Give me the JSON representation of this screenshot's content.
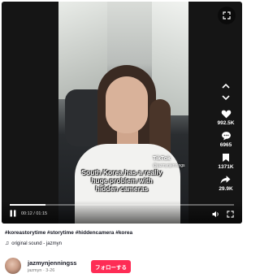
{
  "video": {
    "caption": "South Korea has a really huge problem with hidden cameras",
    "watermark": {
      "brand": "TikTok",
      "handle": "@jazmynjennings"
    },
    "actions": {
      "like_count": "992.5K",
      "comment_count": "6965",
      "save_count": "1371K",
      "share_count": "29.9K"
    },
    "player": {
      "time": "00:12 / 01:15",
      "progress": 0.16
    }
  },
  "post": {
    "hashtags": "#koreastorytime #storytime #hiddencamera #korea",
    "sound": "original sound - jazmyn",
    "author_name": "jazmynjenningss",
    "author_sub": "jazmyn · 3-26",
    "follow_label": "フォローする"
  },
  "colors": {
    "accent": "#fe2c55",
    "text": "#161823",
    "video_bg": "#151515"
  },
  "icons": [
    "expand-icon",
    "chevron-up-icon",
    "chevron-down-icon",
    "heart-icon",
    "comment-icon",
    "bookmark-icon",
    "share-icon",
    "play-pause-icon",
    "volume-icon",
    "fullscreen-icon",
    "music-note-icon"
  ]
}
